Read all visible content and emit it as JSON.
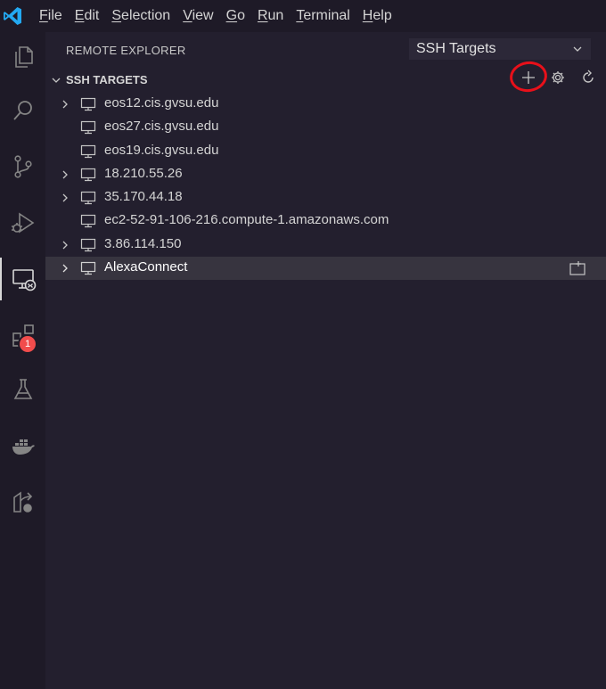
{
  "menu": {
    "items": [
      {
        "label": "File",
        "mnemonic": "F",
        "rest": "ile"
      },
      {
        "label": "Edit",
        "mnemonic": "E",
        "rest": "dit"
      },
      {
        "label": "Selection",
        "mnemonic": "S",
        "rest": "election"
      },
      {
        "label": "View",
        "mnemonic": "V",
        "rest": "iew"
      },
      {
        "label": "Go",
        "mnemonic": "G",
        "rest": "o"
      },
      {
        "label": "Run",
        "mnemonic": "R",
        "rest": "un"
      },
      {
        "label": "Terminal",
        "mnemonic": "T",
        "rest": "erminal"
      },
      {
        "label": "Help",
        "mnemonic": "H",
        "rest": "elp"
      }
    ]
  },
  "activity_bar": {
    "items": [
      "explorer-icon",
      "search-icon",
      "source-control-icon",
      "run-debug-icon",
      "remote-explorer-icon",
      "extensions-icon",
      "testing-icon",
      "docker-icon",
      "live-share-icon"
    ],
    "extensions_badge": "1",
    "active": "remote-explorer-icon"
  },
  "sidebar": {
    "title": "REMOTE EXPLORER",
    "dropdown_value": "SSH Targets",
    "section_title": "SSH TARGETS",
    "section_actions": [
      "add-icon",
      "gear-icon",
      "refresh-icon"
    ],
    "annotation_color": "#e8101a",
    "targets": [
      {
        "label": "eos12.cis.gvsu.edu",
        "expandable": true
      },
      {
        "label": "eos27.cis.gvsu.edu",
        "expandable": false
      },
      {
        "label": "eos19.cis.gvsu.edu",
        "expandable": false
      },
      {
        "label": "18.210.55.26",
        "expandable": true
      },
      {
        "label": "35.170.44.18",
        "expandable": true
      },
      {
        "label": "ec2-52-91-106-216.compute-1.amazonaws.com",
        "expandable": false
      },
      {
        "label": "3.86.114.150",
        "expandable": true
      },
      {
        "label": "AlexaConnect",
        "expandable": true,
        "selected": true
      }
    ]
  },
  "colors": {
    "background": "#231f2e",
    "activity_bar": "#1e1a27",
    "vscode_blue": "#23a9f2",
    "badge": "#f14c4c",
    "selected_row": "#37343f"
  }
}
